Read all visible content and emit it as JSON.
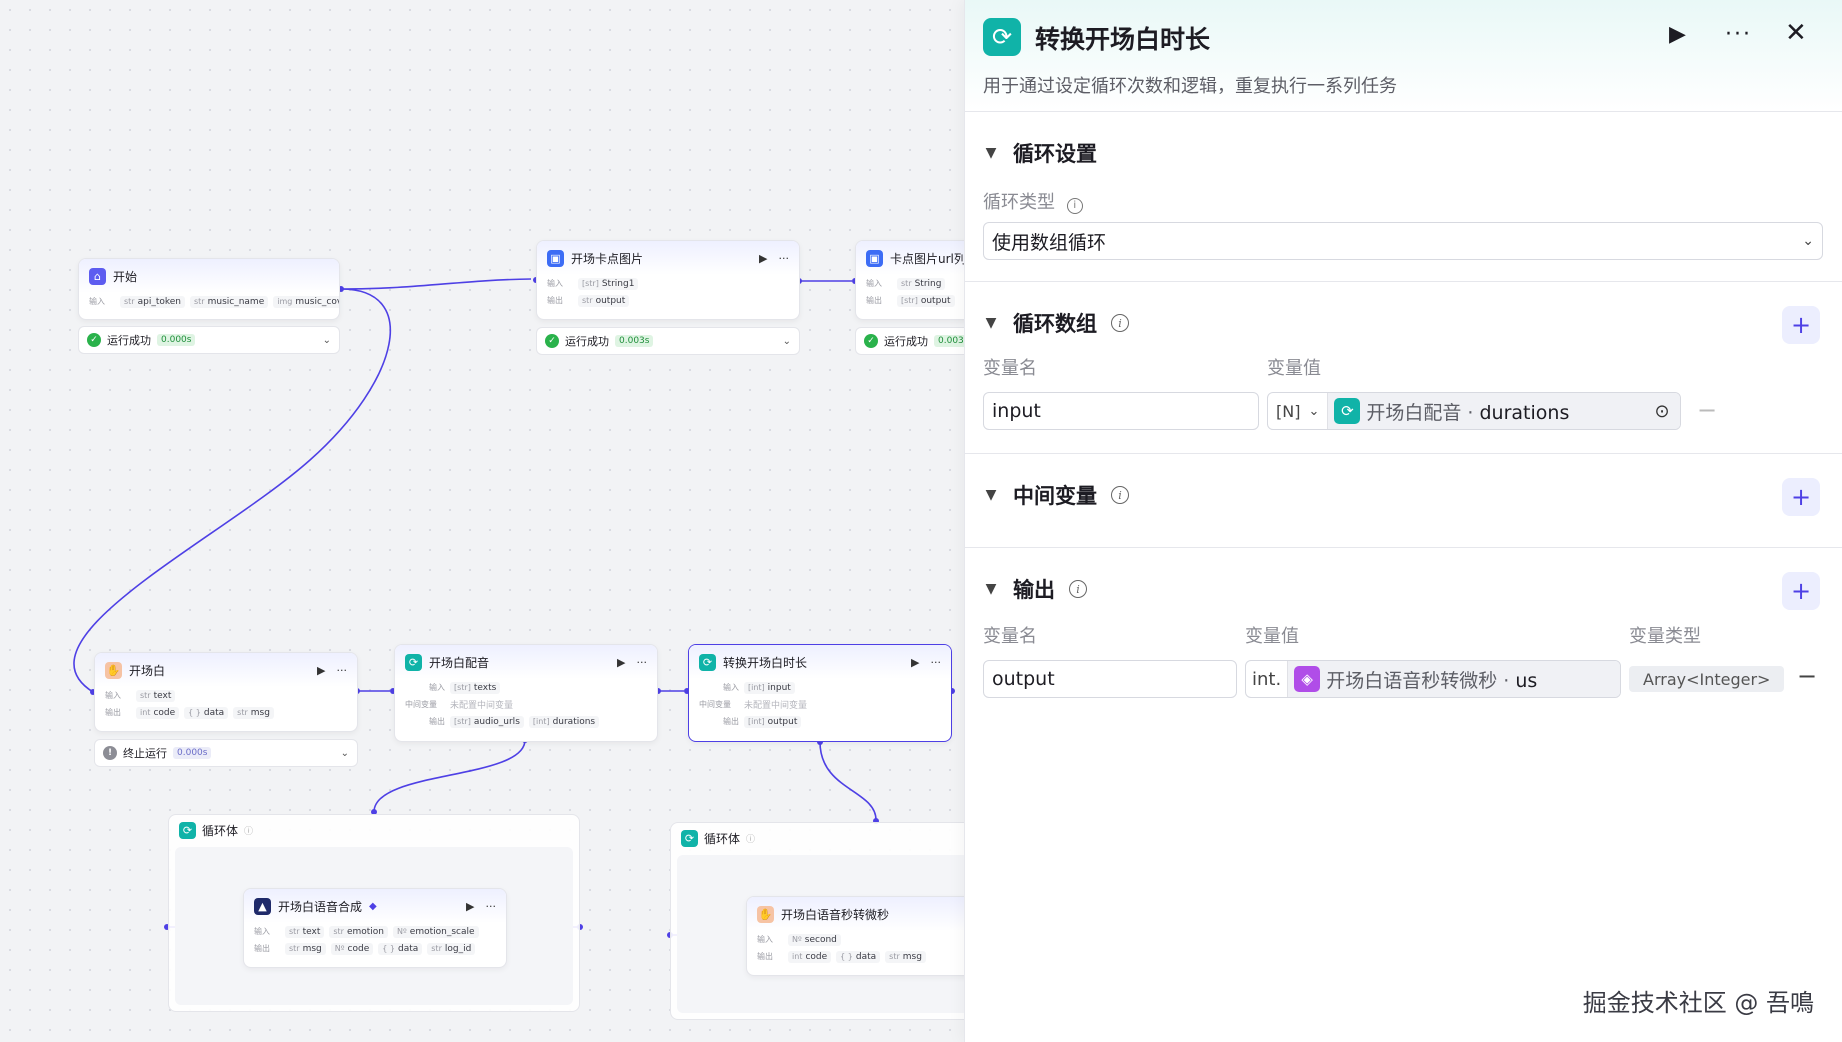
{
  "canvas": {
    "nodes": {
      "start": {
        "title": "开始",
        "in_label": "输入",
        "params": [
          {
            "type": "str",
            "name": "api_token"
          },
          {
            "type": "str",
            "name": "music_name"
          },
          {
            "type": "img",
            "name": "music_cover"
          }
        ],
        "status": "运行成功",
        "time": "0.000s"
      },
      "kaichang_card": {
        "title": "开场卡点图片",
        "in_label": "输入",
        "out_label": "输出",
        "input": {
          "type": "[str]",
          "name": "String1"
        },
        "output": {
          "type": "str",
          "name": "output"
        },
        "status": "运行成功",
        "time": "0.003s"
      },
      "card_url": {
        "title": "卡点图片url列",
        "input": {
          "type": "str",
          "name": "String"
        },
        "output": {
          "type": "[str]",
          "name": "output"
        },
        "status": "运行成功",
        "time": "0.003"
      },
      "kaichangbai": {
        "title": "开场白",
        "input": {
          "type": "str",
          "name": "text"
        },
        "outputs": [
          {
            "type": "int",
            "name": "code"
          },
          {
            "type": "{ }",
            "name": "data"
          },
          {
            "type": "str",
            "name": "msg"
          }
        ],
        "status": "终止运行",
        "time": "0.000s"
      },
      "kaichang_dub": {
        "title": "开场白配音",
        "mid_label": "中间变量",
        "input": {
          "type": "[str]",
          "name": "texts"
        },
        "mid": "未配置中间变量",
        "outputs": [
          {
            "type": "[str]",
            "name": "audio_urls"
          },
          {
            "type": "[int]",
            "name": "durations"
          }
        ]
      },
      "convert_node": {
        "title": "转换开场白时长",
        "input": {
          "type": "[int]",
          "name": "input"
        },
        "mid": "未配置中间变量",
        "output": {
          "type": "[int]",
          "name": "output"
        }
      },
      "loop1": {
        "title": "循环体"
      },
      "tts": {
        "title": "开场白语音合成",
        "inputs": [
          {
            "type": "str",
            "name": "text"
          },
          {
            "type": "str",
            "name": "emotion"
          },
          {
            "type": "Nº",
            "name": "emotion_scale"
          }
        ],
        "outputs": [
          {
            "type": "str",
            "name": "msg"
          },
          {
            "type": "Nº",
            "name": "code"
          },
          {
            "type": "{ }",
            "name": "data"
          },
          {
            "type": "str",
            "name": "log_id"
          }
        ]
      },
      "loop2": {
        "title": "循环体"
      },
      "sec2us": {
        "title": "开场白语音秒转微秒",
        "input": {
          "type": "Nº",
          "name": "second"
        },
        "outputs": [
          {
            "type": "int",
            "name": "code"
          },
          {
            "type": "{ }",
            "name": "data"
          },
          {
            "type": "str",
            "name": "msg"
          }
        ]
      }
    }
  },
  "panel": {
    "title": "转换开场白时长",
    "description": "用于通过设定循环次数和逻辑，重复执行一系列任务",
    "loop_settings": {
      "title": "循环设置",
      "type_label": "循环类型",
      "type_value": "使用数组循环"
    },
    "loop_array": {
      "title": "循环数组",
      "col_name": "变量名",
      "col_value": "变量值",
      "var_name": "input",
      "type_short": "[N]",
      "ref_source": "开场白配音",
      "ref_sep": " · ",
      "ref_field": "durations"
    },
    "intermediate": {
      "title": "中间变量"
    },
    "output": {
      "title": "输出",
      "col_name": "变量名",
      "col_value": "变量值",
      "col_type": "变量类型",
      "var_name": "output",
      "type_short": "int.",
      "ref_source": "开场白语音秒转微秒",
      "ref_sep": " · ",
      "ref_field": "us",
      "var_type": "Array<Integer>"
    }
  },
  "watermark": "掘金技术社区 @ 吾鳴",
  "colors": {
    "accent": "#4e40e5",
    "loop": "#10b3a8",
    "success": "#2ab24b",
    "edge": "#4e40e5"
  }
}
